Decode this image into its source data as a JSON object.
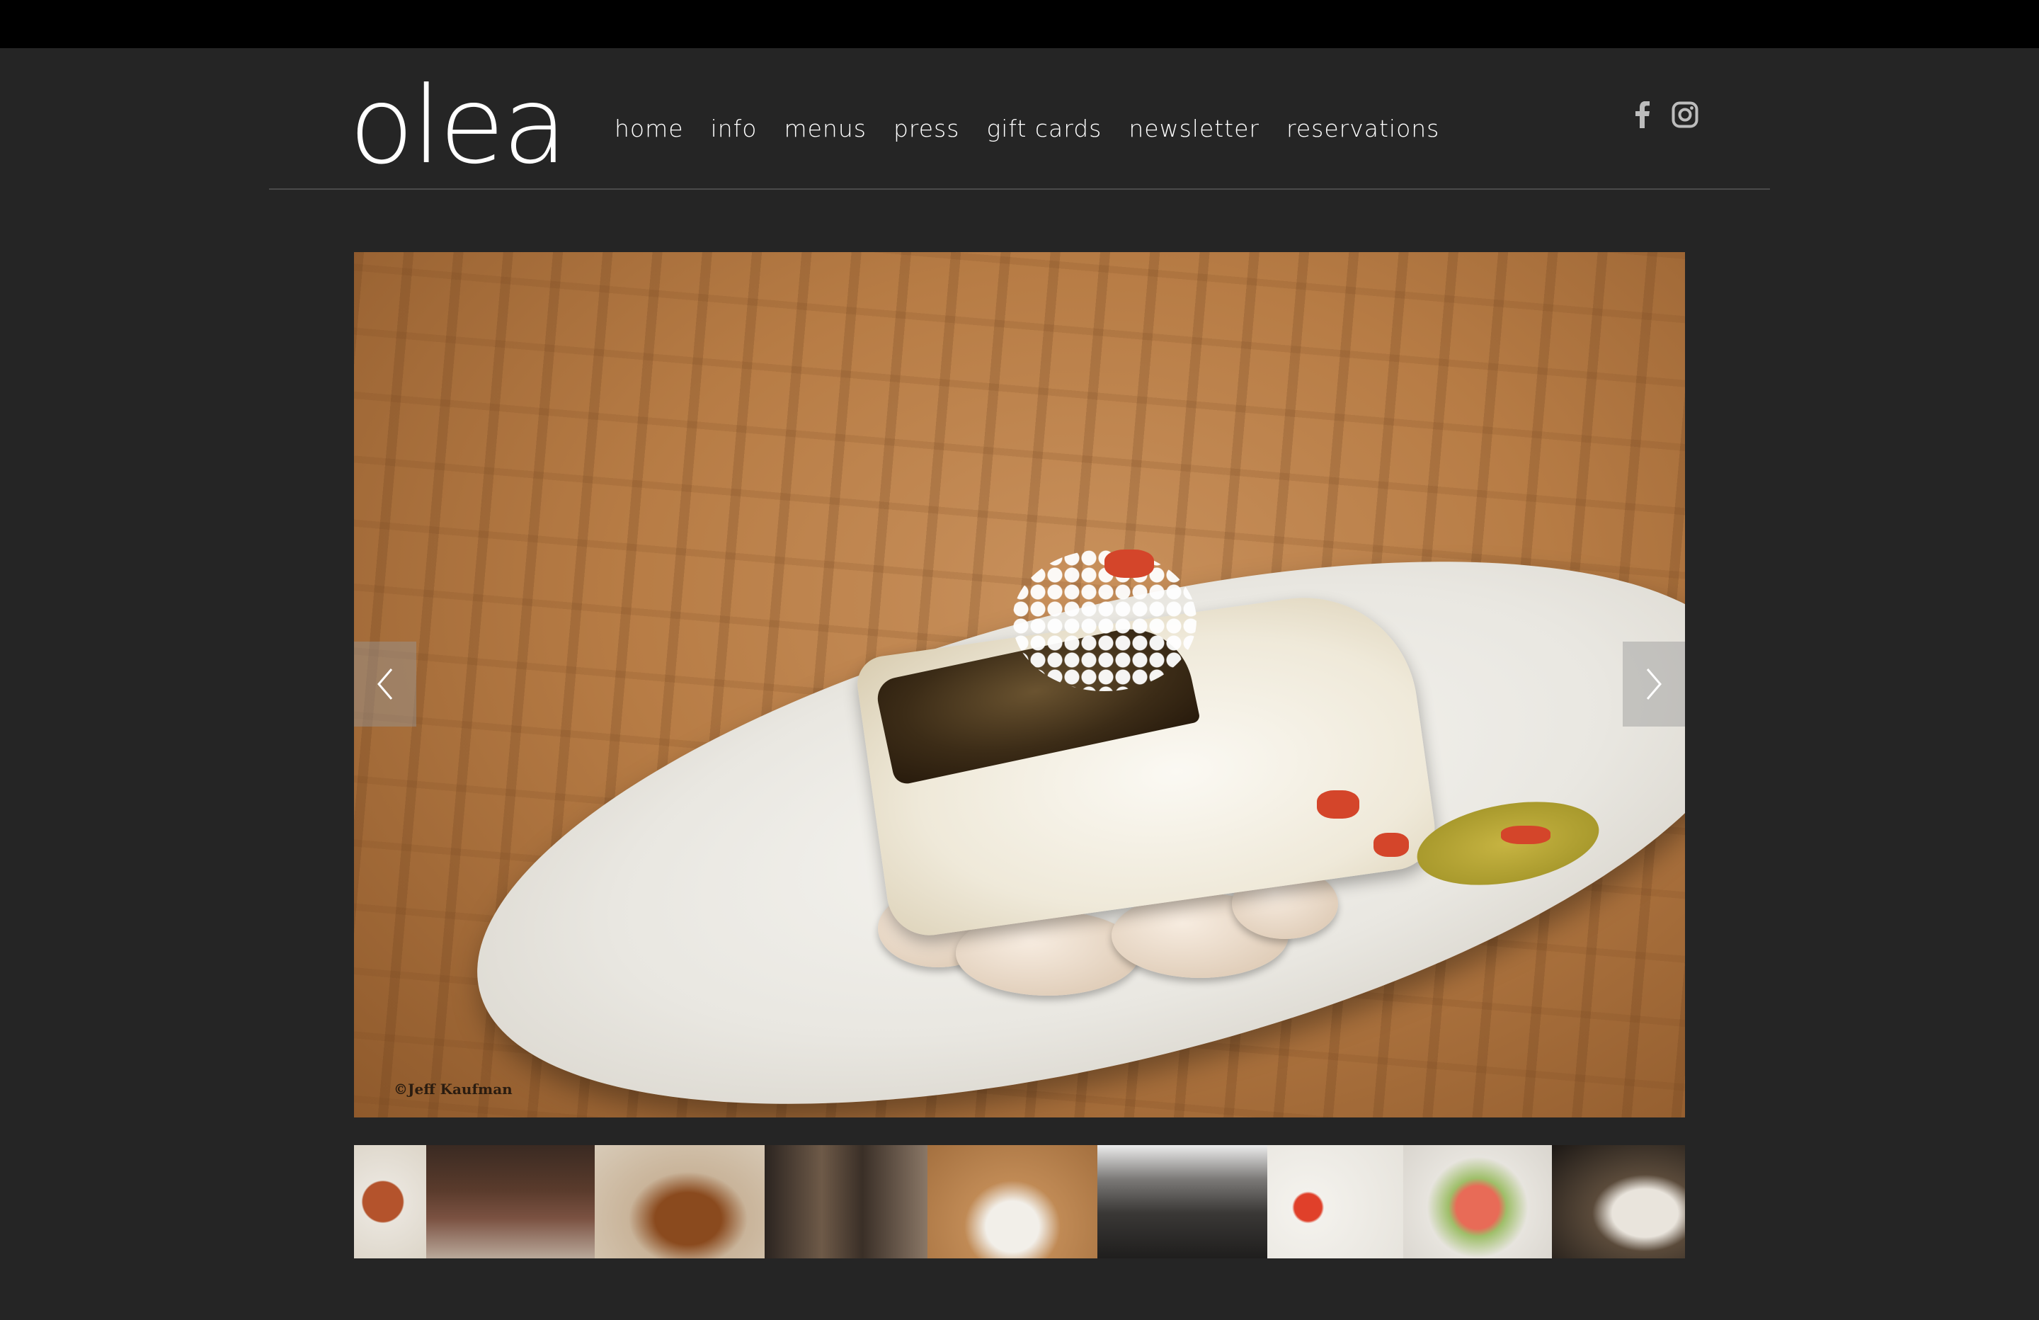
{
  "site": {
    "logo_text": "olea"
  },
  "nav": {
    "items": [
      "home",
      "info",
      "menus",
      "press",
      "gift cards",
      "newsletter",
      "reservations"
    ]
  },
  "social": {
    "facebook_icon": "facebook-icon",
    "instagram_icon": "instagram-icon"
  },
  "gallery": {
    "photo_credit": "©Jeff Kaufman",
    "prev_icon": "chevron-left-icon",
    "next_icon": "chevron-right-icon",
    "thumbnails_count": 9
  },
  "colors": {
    "page_background": "#252525",
    "top_bar": "#000000",
    "text": "#ffffff",
    "divider": "#4a4a4a"
  }
}
